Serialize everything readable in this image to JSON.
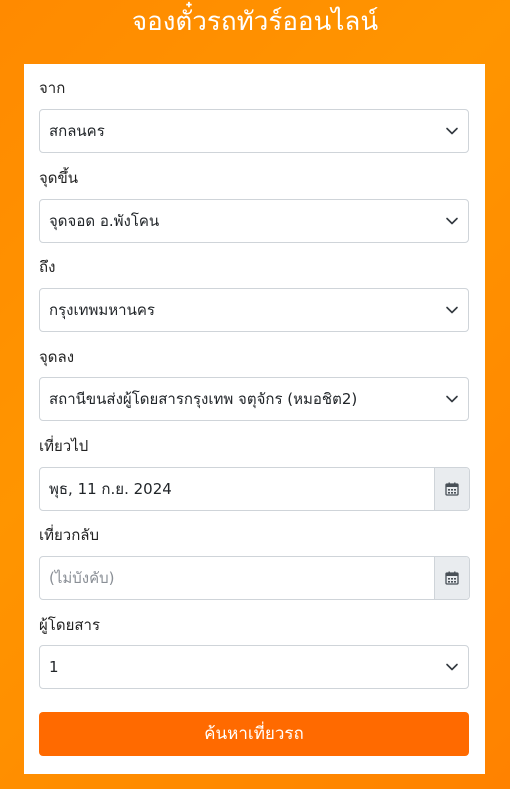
{
  "page": {
    "title": "จองตั๋วรถทัวร์ออนไลน์"
  },
  "form": {
    "from": {
      "label": "จาก",
      "value": "สกลนคร"
    },
    "pickup": {
      "label": "จุดขึ้น",
      "value": "จุดจอด อ.พังโคน"
    },
    "to": {
      "label": "ถึง",
      "value": "กรุงเทพมหานคร"
    },
    "dropoff": {
      "label": "จุดลง",
      "value": "สถานีขนส่งผู้โดยสารกรุงเทพ จตุจักร (หมอชิต2)"
    },
    "depart": {
      "label": "เที่ยวไป",
      "value": "พุธ, 11 ก.ย. 2024"
    },
    "return": {
      "label": "เที่ยวกลับ",
      "placeholder": "(ไม่บังคับ)"
    },
    "passengers": {
      "label": "ผู้โดยสาร",
      "value": "1"
    },
    "submit_label": "ค้นหาเที่ยวรถ"
  },
  "colors": {
    "background": "#ff8a00",
    "button": "#ff6a00",
    "card": "#ffffff"
  },
  "icons": {
    "select": "chevron-down-icon",
    "date": "calendar-icon"
  }
}
